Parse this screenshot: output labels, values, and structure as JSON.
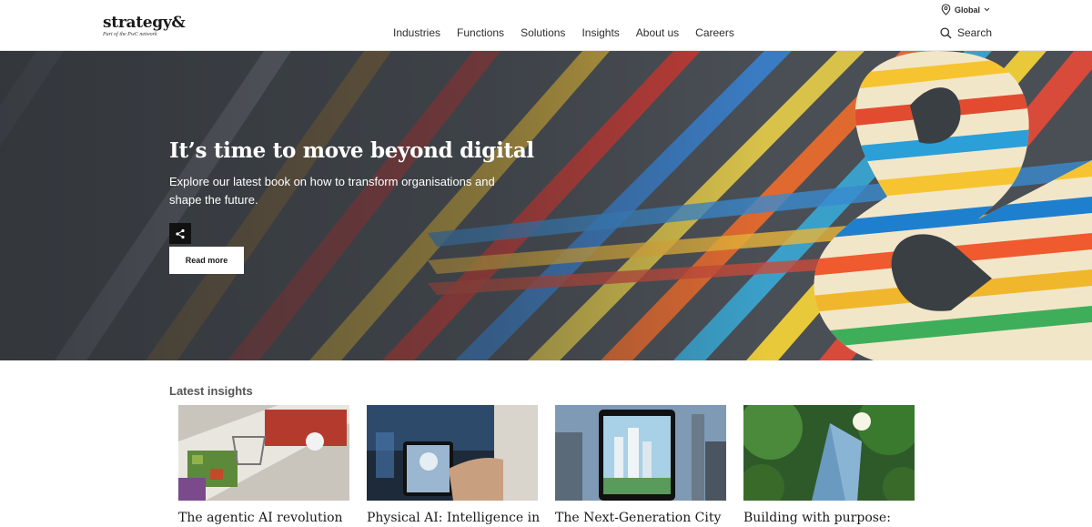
{
  "header": {
    "logo": "strategy&",
    "logo_tagline": "Part of the PwC network",
    "region": "Global",
    "search_label": "Search",
    "nav": [
      "Industries",
      "Functions",
      "Solutions",
      "Insights",
      "About us",
      "Careers"
    ]
  },
  "hero": {
    "title": "It’s time to move beyond digital",
    "subtitle": "Explore our latest book on how to transform organisations and shape the future.",
    "cta_label": "Read more",
    "share_icon": "share-icon"
  },
  "insights": {
    "heading": "Latest insights",
    "cards": [
      {
        "title": "The agentic AI revolution"
      },
      {
        "title": "Physical AI: Intelligence in"
      },
      {
        "title": "The Next-Generation City"
      },
      {
        "title": "Building with purpose:"
      }
    ]
  },
  "colors": {
    "brand_dark": "#1a1a1a",
    "hero_overlay": "#3a3f44"
  }
}
